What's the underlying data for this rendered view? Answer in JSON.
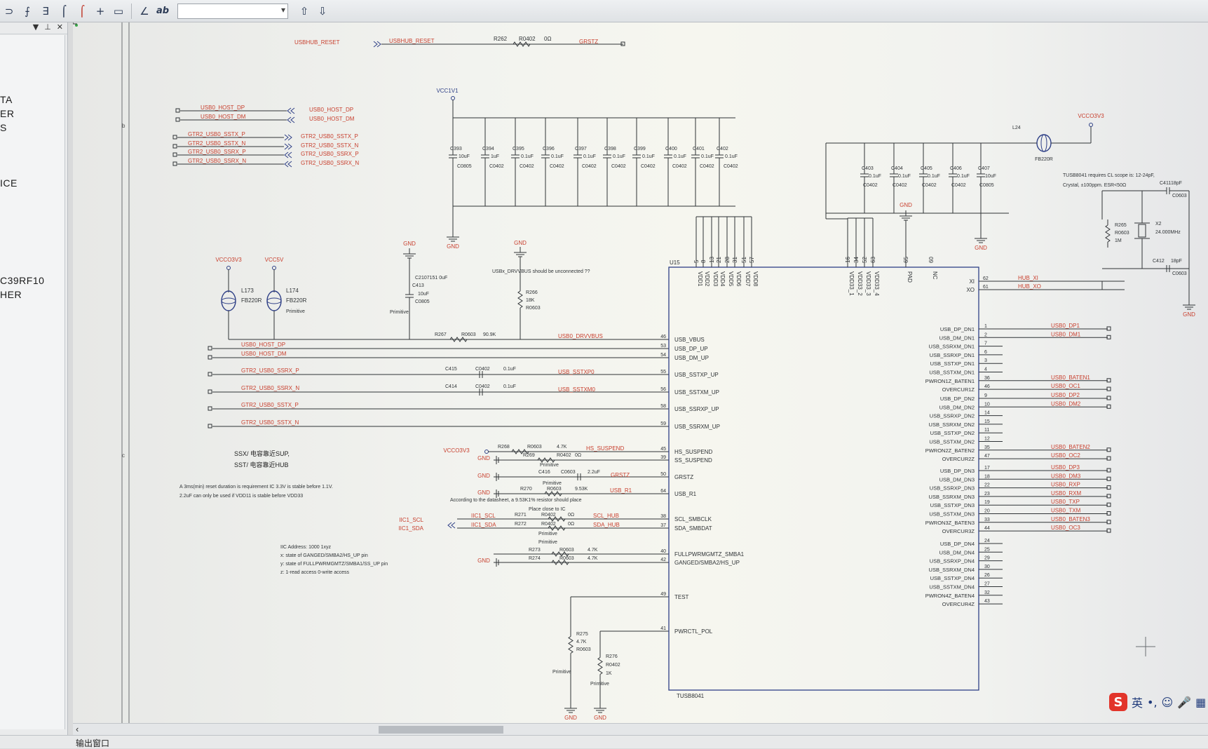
{
  "toolbar": {
    "tools": [
      {
        "icon": "bus-icon",
        "glyph": "⊃"
      },
      {
        "icon": "bus-entry-left-icon",
        "glyph": "⨍"
      },
      {
        "icon": "bus-entry-right-icon",
        "glyph": "∃"
      },
      {
        "icon": "wire-icon",
        "glyph": "⌠"
      },
      {
        "icon": "red-wire-icon",
        "glyph": "⌠"
      },
      {
        "icon": "junction-icon",
        "glyph": "+"
      },
      {
        "icon": "net-label-icon",
        "glyph": "▭"
      }
    ],
    "text_tool": "ab",
    "combo_value": "",
    "up_glyph": "⇧",
    "down_glyph": "⇩"
  },
  "left_panel": {
    "labels": [
      "TA",
      "ER",
      "S",
      "ICE",
      "C39RF10",
      "HER"
    ]
  },
  "schematic": {
    "top": {
      "reset_net": "USBHUB_RESET",
      "r262": "R262",
      "r262_pkg": "R0402",
      "r262_val": "0Ω",
      "grstz": "GRSTZ"
    },
    "host_ports": [
      "USB0_HOST_DP",
      "USB0_HOST_DM"
    ],
    "gtr_ports": [
      "GTR2_USB0_SSTX_P",
      "GTR2_USB0_SSTX_N",
      "GTR2_USB0_SSRX_P",
      "GTR2_USB0_SSRX_N"
    ],
    "vcc1v1": "VCC1V1",
    "caps_1v1": [
      {
        "ref": "C393",
        "val": "10uF",
        "pkg": "C0805"
      },
      {
        "ref": "C394",
        "val": "1uF",
        "pkg": "C0402"
      },
      {
        "ref": "C395",
        "val": "0.1uF",
        "pkg": "C0402"
      },
      {
        "ref": "C396",
        "val": "0.1uF",
        "pkg": "C0402"
      },
      {
        "ref": "C397",
        "val": "0.1uF",
        "pkg": "C0402"
      },
      {
        "ref": "C398",
        "val": "0.1uF",
        "pkg": "C0402"
      },
      {
        "ref": "C399",
        "val": "0.1uF",
        "pkg": "C0402"
      },
      {
        "ref": "C400",
        "val": "0.1uF",
        "pkg": "C0402"
      },
      {
        "ref": "C401",
        "val": "0.1uF",
        "pkg": "C0402"
      },
      {
        "ref": "C402",
        "val": "0.1uF",
        "pkg": "C0402"
      }
    ],
    "gnd": "GND",
    "vccio3v3": "VCCO3V3",
    "vcc5v": "VCC5V",
    "l173": "L173",
    "l174": "L174",
    "fb220r": "FB220R",
    "primitive": "Primitive",
    "c413_note": "C2107151 0uF",
    "c413": "C413",
    "c413_val": "10uF",
    "c413_pkg": "C0805",
    "drvvbus_note": "USBx_DRVVBUS should be unconnected ??",
    "r266": "R266",
    "r266_val": "18K",
    "r266_pkg": "R0603",
    "r267": "R267",
    "r267_pkg": "R0603",
    "r267_val": "90.9K",
    "usb0_drvvbus": "USB0_DRVVBUS",
    "left_nets": [
      "USB0_HOST_DP",
      "USB0_HOST_DM",
      "GTR2_USB0_SSRX_P",
      "GTR2_USB0_SSRX_N",
      "GTR2_USB0_SSTX_P",
      "GTR2_USB0_SSTX_N"
    ],
    "c415": "C415",
    "c414": "C414",
    "c0402": "C0402",
    "cap_01": "0.1uF",
    "sstxp0": "USB_SSTXP0",
    "sstxm0": "USB_SSTXM0",
    "cn_notes": [
      "SSX/ 电容靠近SUP,",
      "SST/ 电容靠近HUB"
    ],
    "reset_note": [
      "A 3ms(min) reset duration is requirement IC 3.3V is stable before 1.1V.",
      "2.2uF can only be used if VDD11 is stable before VDD33"
    ],
    "r268": "R268",
    "r268_pkg": "R0603",
    "r268_val": "4.7K",
    "hs_suspend_net": "HS_SUSPEND",
    "r269": "R269",
    "r269_pkg": "R0402",
    "r269_val": "0Ω",
    "c416": "C416",
    "c416_pkg": "C0603",
    "c416_val": "2.2uF",
    "grstz_net": "GRSTZ",
    "r270": "R270",
    "r270_pkg": "R0603",
    "r270_val": "9.53K",
    "usb_r1_net": "USB_R1",
    "r1_note": "According to the datasheet, a 9.53K1% resistor should place",
    "r1_note2": "Place close to IC",
    "i2c_scl": "IIC1_SCL",
    "i2c_sda": "IIC1_SDA",
    "r271": "R271",
    "r271_pkg": "R0402",
    "r271_val": "0Ω",
    "r272": "R272",
    "r272_pkg": "R0402",
    "r272_val": "0Ω",
    "scl_hub": "SCL_HUB",
    "sda_hub": "SDA_HUB",
    "iic_note": [
      "IIC Address: 1000 1xyz",
      "x: state of GANGED/SMBA2/HS_UP pin",
      "y: state of FULLPWRMGMTZ/SMBA1/SS_UP pin",
      "z: 1-read access     0-write access"
    ],
    "r273": "R273",
    "r273_pkg": "R0603",
    "r273_val": "4.7K",
    "r274": "R274",
    "r274_pkg": "R0603",
    "r274_val": "4.7K",
    "r275": "R275",
    "r275_val": "4.7K",
    "r275_pkg": "R0603",
    "r276": "R276",
    "r276_pkg": "R0402",
    "r276_val": "1K",
    "ic": {
      "ref": "U15",
      "part": "TUSB8041",
      "vdd_pins": [
        {
          "num": "5",
          "name": "VDD1"
        },
        {
          "num": "8",
          "name": "VDD2"
        },
        {
          "num": "13",
          "name": "VDD3"
        },
        {
          "num": "21",
          "name": "VDD4"
        },
        {
          "num": "28",
          "name": "VDD5"
        },
        {
          "num": "31",
          "name": "VDD6"
        },
        {
          "num": "51",
          "name": "VDD7"
        },
        {
          "num": "57",
          "name": "VDD8"
        }
      ],
      "vdd33_pins": [
        {
          "num": "16",
          "name": "VDD33_1"
        },
        {
          "num": "34",
          "name": "VDD33_2"
        },
        {
          "num": "52",
          "name": "VDD33_3"
        },
        {
          "num": "63",
          "name": "VDD33_4"
        }
      ],
      "pad_pin": {
        "num": "65",
        "name": "PAD"
      },
      "nc_pin": {
        "num": "60",
        "name": "NC"
      },
      "left_pins": [
        {
          "num": "46",
          "name": "USB_VBUS"
        },
        {
          "num": "53",
          "name": "USB_DP_UP"
        },
        {
          "num": "54",
          "name": "USB_DM_UP"
        },
        {
          "num": "55",
          "name": "USB_SSTXP_UP"
        },
        {
          "num": "56",
          "name": "USB_SSTXM_UP"
        },
        {
          "num": "58",
          "name": "USB_SSRXP_UP"
        },
        {
          "num": "59",
          "name": "USB_SSRXM_UP"
        },
        {
          "num": "45",
          "name": "HS_SUSPEND"
        },
        {
          "num": "39",
          "name": "SS_SUSPEND"
        },
        {
          "num": "50",
          "name": "GRSTZ"
        },
        {
          "num": "64",
          "name": "USB_R1"
        },
        {
          "num": "38",
          "name": "SCL_SMBCLK"
        },
        {
          "num": "37",
          "name": "SDA_SMBDAT"
        },
        {
          "num": "40",
          "name": "FULLPWRMGMTZ_SMBA1"
        },
        {
          "num": "42",
          "name": "GANGED/SMBA2/HS_UP"
        },
        {
          "num": "49",
          "name": "TEST"
        },
        {
          "num": "41",
          "name": "PWRCTL_POL"
        }
      ],
      "xi": {
        "num": "62",
        "name": "XI",
        "net": "HUB_XI"
      },
      "xo": {
        "num": "61",
        "name": "XO",
        "net": "HUB_XO"
      },
      "right_groups": [
        [
          {
            "num": "1",
            "name": "USB_DP_DN1",
            "net": "USB0_DP1"
          },
          {
            "num": "2",
            "name": "USB_DM_DN1",
            "net": "USB0_DM1"
          },
          {
            "num": "7",
            "name": "USB_SSRXM_DN1",
            "net": ""
          },
          {
            "num": "6",
            "name": "USB_SSRXP_DN1",
            "net": ""
          },
          {
            "num": "3",
            "name": "USB_SSTXP_DN1",
            "net": ""
          },
          {
            "num": "4",
            "name": "USB_SSTXM_DN1",
            "net": ""
          },
          {
            "num": "36",
            "name": "PWRON1Z_BATEN1",
            "net": "USB0_BATEN1"
          },
          {
            "num": "46",
            "name": "OVERCUR1Z",
            "net": "USB0_OC1"
          }
        ],
        [
          {
            "num": "9",
            "name": "USB_DP_DN2",
            "net": "USB0_DP2"
          },
          {
            "num": "10",
            "name": "USB_DM_DN2",
            "net": "USB0_DM2"
          },
          {
            "num": "14",
            "name": "USB_SSRXP_DN2",
            "net": ""
          },
          {
            "num": "15",
            "name": "USB_SSRXM_DN2",
            "net": ""
          },
          {
            "num": "11",
            "name": "USB_SSTXP_DN2",
            "net": ""
          },
          {
            "num": "12",
            "name": "USB_SSTXM_DN2",
            "net": ""
          },
          {
            "num": "35",
            "name": "PWRON2Z_BATEN2",
            "net": "USB0_BATEN2"
          },
          {
            "num": "47",
            "name": "OVERCUR2Z",
            "net": "USB0_OC2"
          }
        ],
        [
          {
            "num": "17",
            "name": "USB_DP_DN3",
            "net": "USB0_DP3"
          },
          {
            "num": "18",
            "name": "USB_DM_DN3",
            "net": "USB0_DM3"
          },
          {
            "num": "22",
            "name": "USB_SSRXP_DN3",
            "net": "USB0_RXP"
          },
          {
            "num": "23",
            "name": "USB_SSRXM_DN3",
            "net": "USB0_RXM"
          },
          {
            "num": "19",
            "name": "USB_SSTXP_DN3",
            "net": "USB0_TXP"
          },
          {
            "num": "20",
            "name": "USB_SSTXM_DN3",
            "net": "USB0_TXM"
          },
          {
            "num": "33",
            "name": "PWRON3Z_BATEN3",
            "net": "USB0_BATEN3"
          },
          {
            "num": "44",
            "name": "OVERCUR3Z",
            "net": "USB0_OC3"
          }
        ],
        [
          {
            "num": "24",
            "name": "USB_DP_DN4",
            "net": ""
          },
          {
            "num": "25",
            "name": "USB_DM_DN4",
            "net": ""
          },
          {
            "num": "29",
            "name": "USB_SSRXP_DN4",
            "net": ""
          },
          {
            "num": "30",
            "name": "USB_SSRXM_DN4",
            "net": ""
          },
          {
            "num": "26",
            "name": "USB_SSTXP_DN4",
            "net": ""
          },
          {
            "num": "27",
            "name": "USB_SSTXM_DN4",
            "net": ""
          },
          {
            "num": "32",
            "name": "PWRON4Z_BATEN4",
            "net": ""
          },
          {
            "num": "43",
            "name": "OVERCUR4Z",
            "net": ""
          }
        ]
      ]
    },
    "caps_3v3": [
      {
        "ref": "C403",
        "val": "0.1uF",
        "pkg": "C0402"
      },
      {
        "ref": "C404",
        "val": "0.1uF",
        "pkg": "C0402"
      },
      {
        "ref": "C405",
        "val": "0.1uF",
        "pkg": "C0402"
      },
      {
        "ref": "C406",
        "val": "0.1uF",
        "pkg": "C0402"
      },
      {
        "ref": "C407",
        "val": "10uF",
        "pkg": "C0805"
      }
    ],
    "l24": "L24",
    "crystal_note": [
      "TUSB8041 requires CL scope is: 12-24pF,",
      "Crystal, ±100ppm. ESR<50Ω"
    ],
    "c411": "C411",
    "c411_val": "18pF",
    "c411_pkg": "C0603",
    "c412": "C412",
    "c412_val": "18pF",
    "c412_pkg": "C0603",
    "r265": "R265",
    "r265_pkg": "R0603",
    "r265_val": "1M",
    "x2": "X2",
    "x2_val": "24.000MHz",
    "margin_marks": [
      "b",
      "c"
    ]
  },
  "bottom": {
    "output_label": "输出窗口",
    "scroll_left": "‹"
  },
  "ime": {
    "logo": "S",
    "items": [
      "英",
      "•,",
      "☺",
      "🎤",
      "▦"
    ]
  }
}
